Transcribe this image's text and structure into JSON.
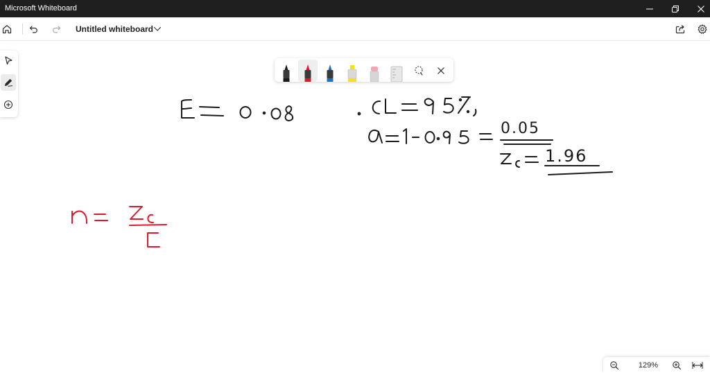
{
  "window": {
    "title": "Microsoft Whiteboard"
  },
  "header": {
    "document_title": "Untitled whiteboard"
  },
  "zoom": {
    "level": "129%"
  },
  "colors": {
    "ink_black": "#1a1a1a",
    "ink_red": "#e0182d",
    "pen_blue": "#1f6fd1",
    "highlighter_yellow": "#f2e21b",
    "titlebar_bg": "#1f1f1f"
  },
  "canvas": {
    "ink_lines": [
      {
        "text": "E = 0.08",
        "color": "ink_black"
      },
      {
        "text": "CL = 95%,",
        "color": "ink_black"
      },
      {
        "text": "α = 1 − 0.95 =",
        "color": "ink_black"
      },
      {
        "text": "0.05",
        "color": "ink_black"
      },
      {
        "text": "z",
        "color": "ink_black"
      },
      {
        "text": "c",
        "color": "ink_black"
      },
      {
        "text": "=",
        "color": "ink_black"
      },
      {
        "text": "1.96",
        "color": "ink_black"
      },
      {
        "text": "n =",
        "color": "ink_red"
      },
      {
        "text": "zc",
        "color": "ink_red"
      },
      {
        "text": "E",
        "color": "ink_red"
      }
    ]
  },
  "icons": {
    "window": [
      "minimize-icon",
      "restore-icon",
      "close-icon"
    ],
    "header": [
      "home-icon",
      "undo-icon",
      "redo-icon",
      "chevron-down-icon",
      "share-icon",
      "gear-icon"
    ],
    "rail": [
      "select-pointer-icon",
      "ink-pen-icon",
      "add-icon"
    ],
    "pen_toolbar": [
      "black-pen-icon",
      "red-pen-icon",
      "blue-pen-icon",
      "yellow-highlighter-icon",
      "eraser-icon",
      "ruler-icon",
      "lasso-select-icon",
      "close-icon"
    ],
    "zoom": [
      "zoom-out-icon",
      "zoom-in-icon",
      "fit-to-screen-icon"
    ]
  }
}
